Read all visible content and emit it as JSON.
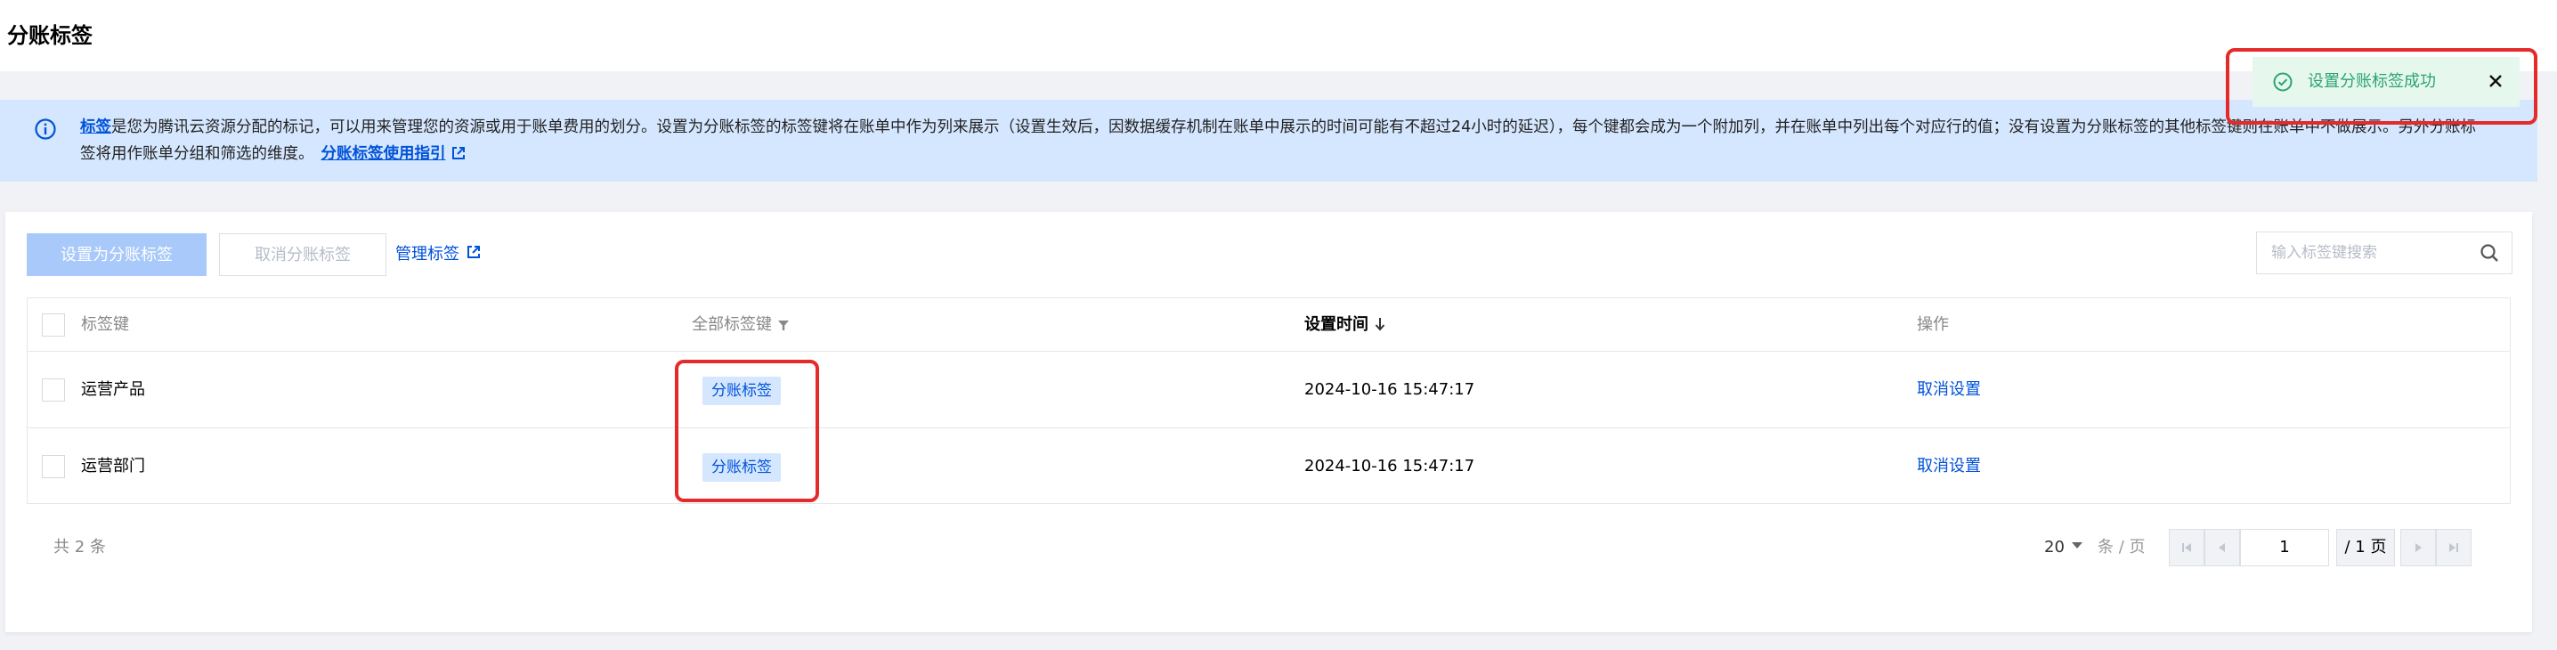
{
  "page": {
    "title": "分账标签"
  },
  "notice": {
    "link_text": "标签",
    "text": "是您为腾讯云资源分配的标记，可以用来管理您的资源或用于账单费用的划分。设置为分账标签的标签键将在账单中作为列来展示（设置生效后，因数据缓存机制在账单中展示的时间可能有不超过24小时的延迟），每个键都会成为一个附加列，并在账单中列出每个对应行的值；没有设置为分账标签的其他标签键则在账单中不做展示。另外分账标签将用作账单分组和筛选的维度。",
    "guide_link": "分账标签使用指引"
  },
  "toolbar": {
    "set_label": "设置为分账标签",
    "cancel_label": "取消分账标签",
    "manage_label": "管理标签",
    "search_placeholder": "输入标签键搜索"
  },
  "table": {
    "headers": {
      "key": "标签键",
      "all_tags": "全部标签键",
      "time": "设置时间",
      "ops": "操作"
    },
    "rows": [
      {
        "key": "运营产品",
        "tag": "分账标签",
        "time": "2024-10-16 15:47:17",
        "action": "取消设置"
      },
      {
        "key": "运营部门",
        "tag": "分账标签",
        "time": "2024-10-16 15:47:17",
        "action": "取消设置"
      }
    ]
  },
  "pagination": {
    "total_text": "共 2 条",
    "page_size": "20",
    "page_size_unit": "条 / 页",
    "current_page": "1",
    "total_pages": "/ 1 页"
  },
  "toast": {
    "message": "设置分账标签成功"
  },
  "colors": {
    "brand": "#0052d9",
    "success": "#2ba471",
    "highlight": "#e52a2a"
  }
}
